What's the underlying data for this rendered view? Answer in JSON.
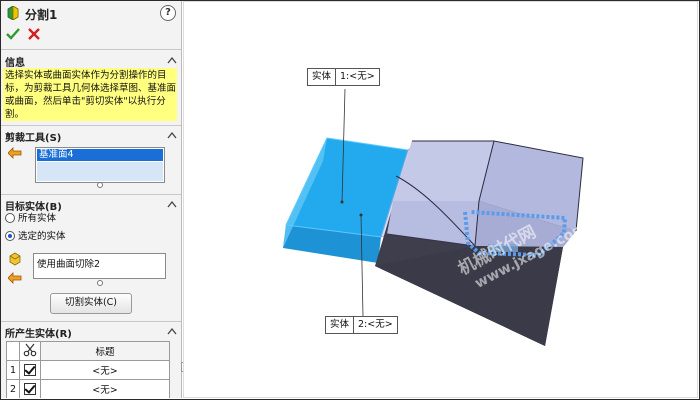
{
  "feature": {
    "title": "分割1",
    "help": "?"
  },
  "info": {
    "header": "信息",
    "text": "选择实体或曲面实体作为分割操作的目标，为剪裁工具几何体选择草图、基准面或曲面，然后单击\"剪切实体\"以执行分割。"
  },
  "trim_tools": {
    "header": "剪裁工具(S)",
    "selected_item": "基准面4"
  },
  "target_bodies": {
    "header": "目标实体(B)",
    "options": [
      "所有实体",
      "选定的实体"
    ],
    "selected_option": "选定的实体",
    "selected_body": "使用曲面切除2",
    "cut_button": "切割实体(C)"
  },
  "resulting_bodies": {
    "header": "所产生实体(R)",
    "column_title": "标题",
    "rows": [
      {
        "num": "1",
        "checked": true,
        "title": "<无>"
      },
      {
        "num": "2",
        "checked": true,
        "title": "<无>"
      }
    ]
  },
  "viewport": {
    "callouts": [
      {
        "label": "实体",
        "value": "1:<无>"
      },
      {
        "label": "实体",
        "value": "2:<无>"
      }
    ],
    "watermark": [
      "机械时代网",
      "www.jxage.com"
    ]
  }
}
